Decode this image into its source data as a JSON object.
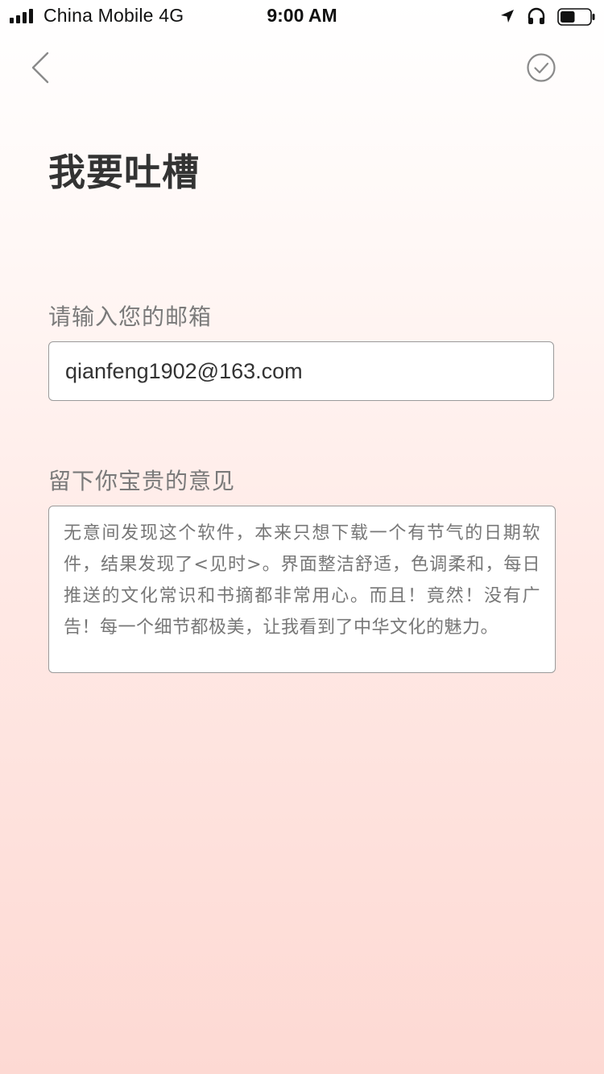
{
  "status_bar": {
    "carrier": "China Mobile  4G",
    "time": "9:00 AM",
    "icons": [
      "signal-icon",
      "location-arrow-icon",
      "headphones-icon",
      "battery-icon"
    ],
    "battery_level": 0.5
  },
  "nav": {
    "back_icon": "chevron-left-icon",
    "confirm_icon": "check-circle-icon"
  },
  "page": {
    "title": "我要吐槽"
  },
  "form": {
    "email_label": "请输入您的邮箱",
    "email_value": "qianfeng1902@163.com",
    "feedback_label": "留下你宝贵的意见",
    "feedback_value": "无意间发现这个软件，本来只想下载一个有节气的日期软件，结果发现了<见时>。界面整洁舒适，色调柔和，每日推送的文化常识和书摘都非常用心。而且！竟然！没有广告！每一个细节都极美，让我看到了中华文化的魅力。"
  },
  "colors": {
    "background_top": "#ffffff",
    "background_bottom": "#fdd9d3",
    "title": "#333333",
    "label": "#7a7a7a",
    "field_border": "#9a9a9a",
    "icon": "#8a8a8a"
  }
}
